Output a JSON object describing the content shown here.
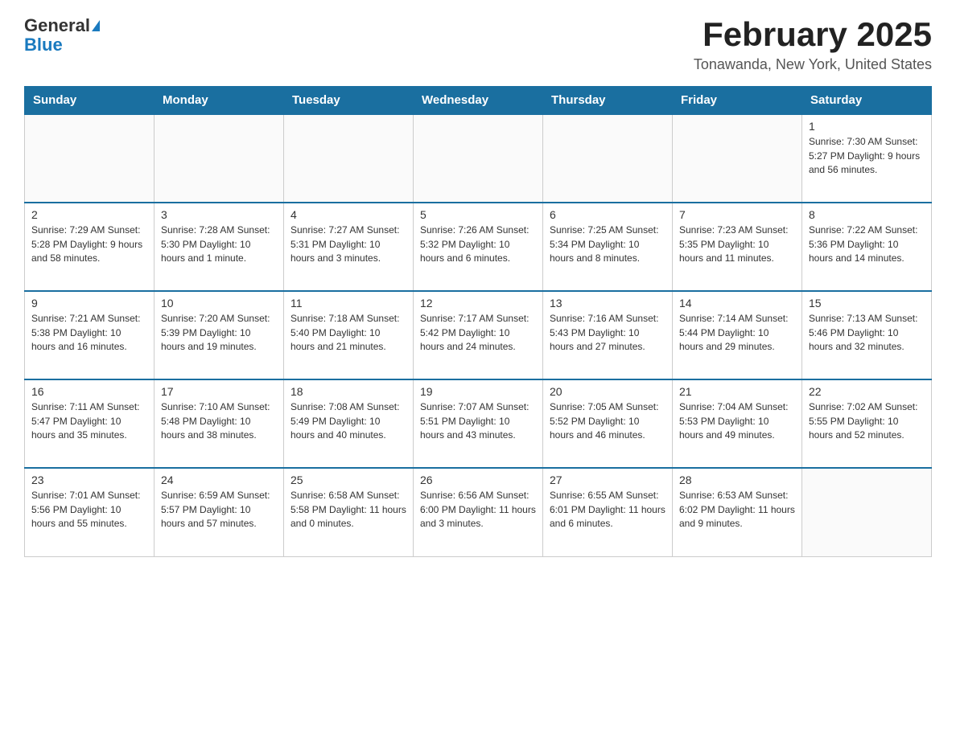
{
  "header": {
    "logo_general": "General",
    "logo_blue": "Blue",
    "title": "February 2025",
    "subtitle": "Tonawanda, New York, United States"
  },
  "weekdays": [
    "Sunday",
    "Monday",
    "Tuesday",
    "Wednesday",
    "Thursday",
    "Friday",
    "Saturday"
  ],
  "weeks": [
    [
      {
        "day": "",
        "info": ""
      },
      {
        "day": "",
        "info": ""
      },
      {
        "day": "",
        "info": ""
      },
      {
        "day": "",
        "info": ""
      },
      {
        "day": "",
        "info": ""
      },
      {
        "day": "",
        "info": ""
      },
      {
        "day": "1",
        "info": "Sunrise: 7:30 AM\nSunset: 5:27 PM\nDaylight: 9 hours and 56 minutes."
      }
    ],
    [
      {
        "day": "2",
        "info": "Sunrise: 7:29 AM\nSunset: 5:28 PM\nDaylight: 9 hours and 58 minutes."
      },
      {
        "day": "3",
        "info": "Sunrise: 7:28 AM\nSunset: 5:30 PM\nDaylight: 10 hours and 1 minute."
      },
      {
        "day": "4",
        "info": "Sunrise: 7:27 AM\nSunset: 5:31 PM\nDaylight: 10 hours and 3 minutes."
      },
      {
        "day": "5",
        "info": "Sunrise: 7:26 AM\nSunset: 5:32 PM\nDaylight: 10 hours and 6 minutes."
      },
      {
        "day": "6",
        "info": "Sunrise: 7:25 AM\nSunset: 5:34 PM\nDaylight: 10 hours and 8 minutes."
      },
      {
        "day": "7",
        "info": "Sunrise: 7:23 AM\nSunset: 5:35 PM\nDaylight: 10 hours and 11 minutes."
      },
      {
        "day": "8",
        "info": "Sunrise: 7:22 AM\nSunset: 5:36 PM\nDaylight: 10 hours and 14 minutes."
      }
    ],
    [
      {
        "day": "9",
        "info": "Sunrise: 7:21 AM\nSunset: 5:38 PM\nDaylight: 10 hours and 16 minutes."
      },
      {
        "day": "10",
        "info": "Sunrise: 7:20 AM\nSunset: 5:39 PM\nDaylight: 10 hours and 19 minutes."
      },
      {
        "day": "11",
        "info": "Sunrise: 7:18 AM\nSunset: 5:40 PM\nDaylight: 10 hours and 21 minutes."
      },
      {
        "day": "12",
        "info": "Sunrise: 7:17 AM\nSunset: 5:42 PM\nDaylight: 10 hours and 24 minutes."
      },
      {
        "day": "13",
        "info": "Sunrise: 7:16 AM\nSunset: 5:43 PM\nDaylight: 10 hours and 27 minutes."
      },
      {
        "day": "14",
        "info": "Sunrise: 7:14 AM\nSunset: 5:44 PM\nDaylight: 10 hours and 29 minutes."
      },
      {
        "day": "15",
        "info": "Sunrise: 7:13 AM\nSunset: 5:46 PM\nDaylight: 10 hours and 32 minutes."
      }
    ],
    [
      {
        "day": "16",
        "info": "Sunrise: 7:11 AM\nSunset: 5:47 PM\nDaylight: 10 hours and 35 minutes."
      },
      {
        "day": "17",
        "info": "Sunrise: 7:10 AM\nSunset: 5:48 PM\nDaylight: 10 hours and 38 minutes."
      },
      {
        "day": "18",
        "info": "Sunrise: 7:08 AM\nSunset: 5:49 PM\nDaylight: 10 hours and 40 minutes."
      },
      {
        "day": "19",
        "info": "Sunrise: 7:07 AM\nSunset: 5:51 PM\nDaylight: 10 hours and 43 minutes."
      },
      {
        "day": "20",
        "info": "Sunrise: 7:05 AM\nSunset: 5:52 PM\nDaylight: 10 hours and 46 minutes."
      },
      {
        "day": "21",
        "info": "Sunrise: 7:04 AM\nSunset: 5:53 PM\nDaylight: 10 hours and 49 minutes."
      },
      {
        "day": "22",
        "info": "Sunrise: 7:02 AM\nSunset: 5:55 PM\nDaylight: 10 hours and 52 minutes."
      }
    ],
    [
      {
        "day": "23",
        "info": "Sunrise: 7:01 AM\nSunset: 5:56 PM\nDaylight: 10 hours and 55 minutes."
      },
      {
        "day": "24",
        "info": "Sunrise: 6:59 AM\nSunset: 5:57 PM\nDaylight: 10 hours and 57 minutes."
      },
      {
        "day": "25",
        "info": "Sunrise: 6:58 AM\nSunset: 5:58 PM\nDaylight: 11 hours and 0 minutes."
      },
      {
        "day": "26",
        "info": "Sunrise: 6:56 AM\nSunset: 6:00 PM\nDaylight: 11 hours and 3 minutes."
      },
      {
        "day": "27",
        "info": "Sunrise: 6:55 AM\nSunset: 6:01 PM\nDaylight: 11 hours and 6 minutes."
      },
      {
        "day": "28",
        "info": "Sunrise: 6:53 AM\nSunset: 6:02 PM\nDaylight: 11 hours and 9 minutes."
      },
      {
        "day": "",
        "info": ""
      }
    ]
  ]
}
